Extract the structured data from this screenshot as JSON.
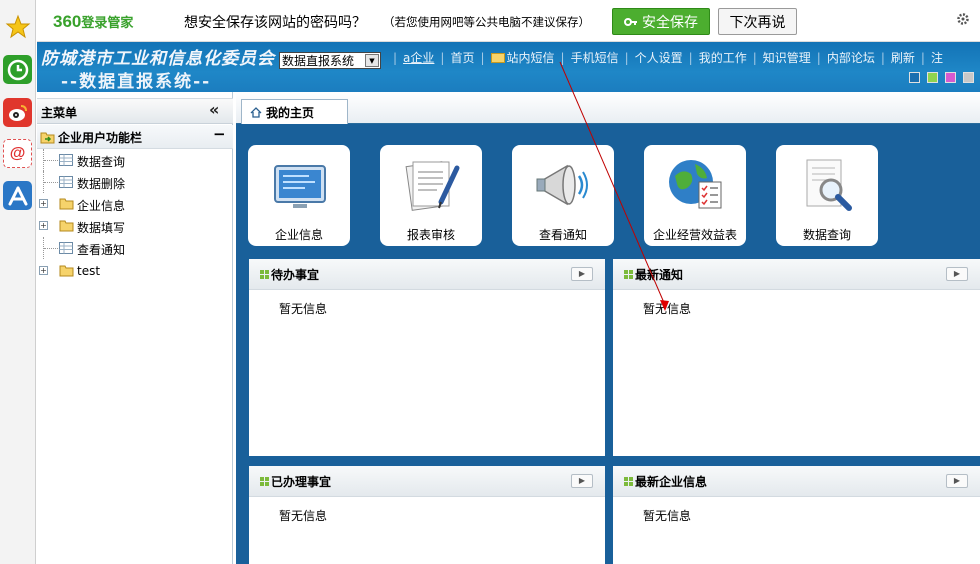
{
  "bar360": {
    "logo": "360",
    "logo_suffix": "登录管家",
    "message": "想安全保存该网站的密码吗？",
    "note": "（若您使用网吧等公共电脑不建议保存）",
    "save_button": "安全保存",
    "later_button": "下次再说"
  },
  "header": {
    "org_title": "防城港市工业和信息化委员会",
    "system_title": "--数据直报系统--",
    "system_select": "数据直报系统",
    "nav": [
      "a企业",
      "首页",
      "站内短信",
      "手机短信",
      "个人设置",
      "我的工作",
      "知识管理",
      "内部论坛",
      "刷新",
      "注"
    ],
    "swatches": [
      "#1a6fb0",
      "#8fd44f",
      "#d65ad0",
      "#c8c8c8"
    ]
  },
  "sidebar": {
    "title": "主菜单",
    "collapse": "«",
    "category": "企业用户功能栏",
    "category_toggle": "−",
    "items": [
      {
        "label": "数据查询",
        "type": "page"
      },
      {
        "label": "数据删除",
        "type": "page"
      },
      {
        "label": "企业信息",
        "type": "folder"
      },
      {
        "label": "数据填写",
        "type": "folder"
      },
      {
        "label": "查看通知",
        "type": "page"
      },
      {
        "label": "test",
        "type": "folder"
      }
    ]
  },
  "tabs": [
    {
      "label": "我的主页"
    }
  ],
  "quick_links": [
    {
      "label": "企业信息",
      "icon": "monitor-icon"
    },
    {
      "label": "报表审核",
      "icon": "document-pen-icon"
    },
    {
      "label": "查看通知",
      "icon": "megaphone-icon"
    },
    {
      "label": "企业经营效益表",
      "icon": "globe-checklist-icon"
    },
    {
      "label": "数据查询",
      "icon": "search-document-icon"
    }
  ],
  "portlets": [
    {
      "title": "待办事宜",
      "empty": "暂无信息"
    },
    {
      "title": "最新通知",
      "empty": "暂无信息"
    },
    {
      "title": "已办理事宜",
      "empty": "暂无信息"
    },
    {
      "title": "最新企业信息",
      "empty": "暂无信息"
    }
  ]
}
